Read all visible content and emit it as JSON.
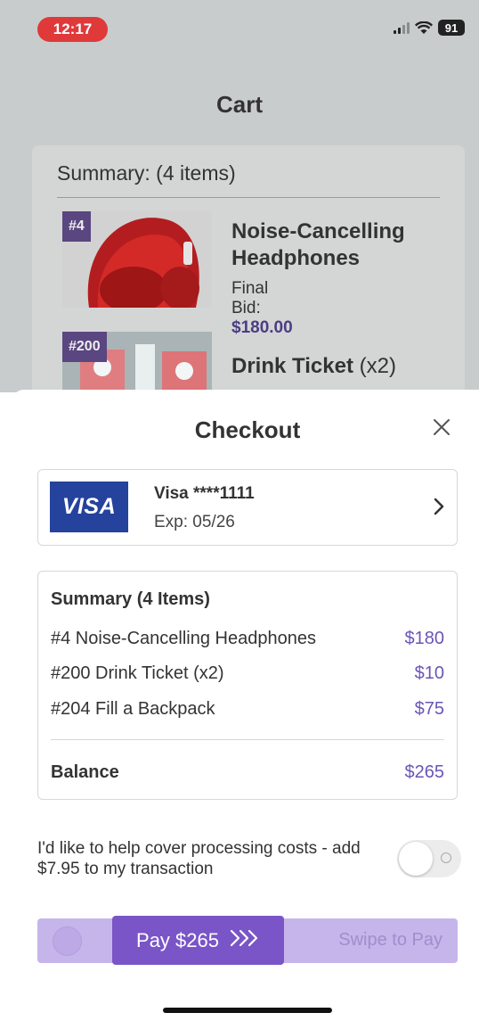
{
  "status_bar": {
    "time": "12:17",
    "battery": "91"
  },
  "cart": {
    "title": "Cart",
    "summary": "Summary: (4 items)",
    "items": [
      {
        "badge": "#4",
        "name": "Noise-Cancelling Headphones",
        "bid_label": "Final Bid: ",
        "bid_value": "$180.00"
      },
      {
        "badge": "#200",
        "name": "Drink Ticket",
        "qty": "(x2)"
      }
    ]
  },
  "checkout": {
    "title": "Checkout",
    "card": {
      "brand": "VISA",
      "name": "Visa ****1111",
      "exp": "Exp: 05/26"
    },
    "summary": {
      "title": "Summary (4 Items)",
      "lines": [
        {
          "label": "#4 Noise-Cancelling Headphones",
          "amount": "$180"
        },
        {
          "label": "#200 Drink Ticket (x2)",
          "amount": "$10"
        },
        {
          "label": "#204 Fill a Backpack",
          "amount": "$75"
        }
      ],
      "balance_label": "Balance",
      "balance_amount": "$265"
    },
    "processing": {
      "text": "I'd like to help cover processing costs - add $7.95 to my transaction",
      "enabled": false
    },
    "pay": {
      "label": "Pay $265",
      "arrows": "»»",
      "hint": "Swipe to Pay"
    }
  },
  "colors": {
    "accent": "#7a55c7",
    "amount": "#6b55b5",
    "visa": "#25429c",
    "time_pill": "#e0393a"
  }
}
